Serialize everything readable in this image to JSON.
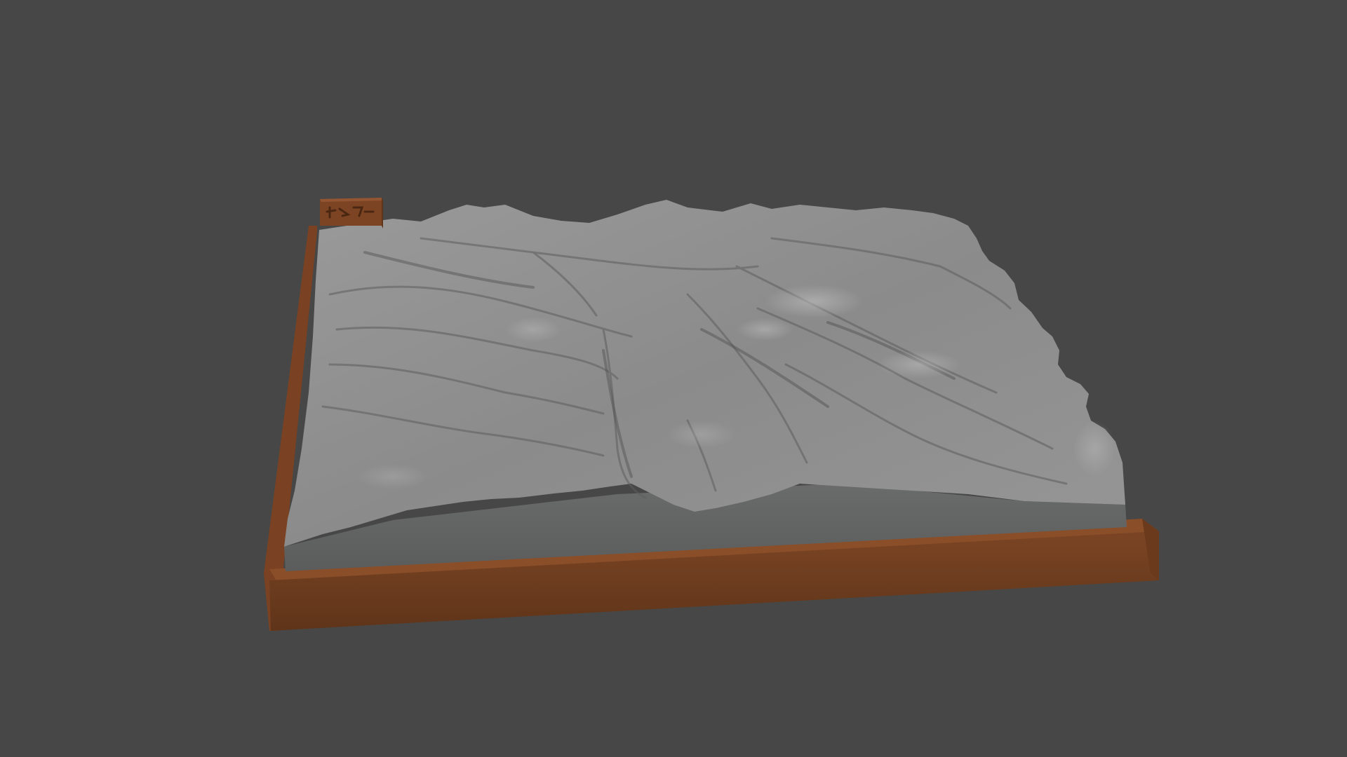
{
  "scene": {
    "background_color": "#474747",
    "subject": "terrain-relief-model",
    "terrain_color": "#8e8e8e",
    "terrain_shadow_color": "#5f6060",
    "base_color": "#6e3d1e",
    "base_top_color": "#8a4e29",
    "tag_icon": "engraved-label-icon"
  }
}
